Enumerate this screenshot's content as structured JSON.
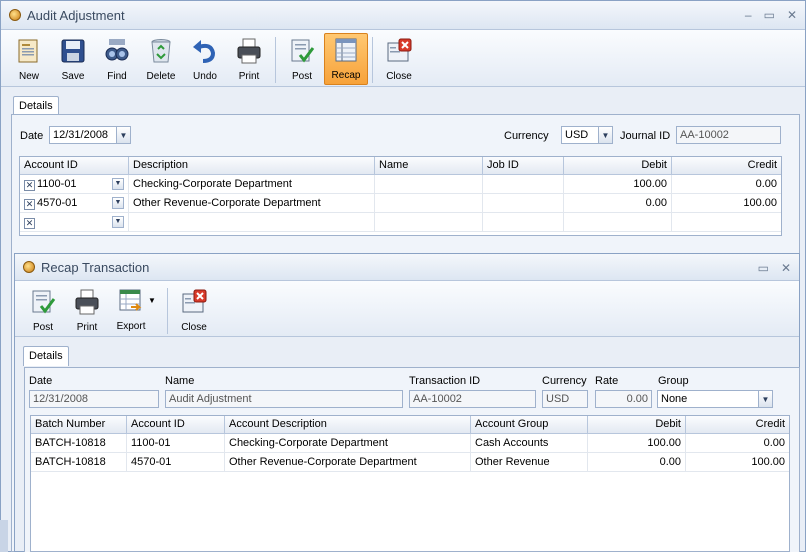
{
  "main_window": {
    "title": "Audit Adjustment",
    "toolbar": [
      {
        "label": "New",
        "icon": "new-icon"
      },
      {
        "label": "Save",
        "icon": "save-icon"
      },
      {
        "label": "Find",
        "icon": "find-icon"
      },
      {
        "label": "Delete",
        "icon": "delete-icon"
      },
      {
        "label": "Undo",
        "icon": "undo-icon"
      },
      {
        "label": "Print",
        "icon": "print-icon"
      },
      {
        "label": "Post",
        "icon": "post-icon"
      },
      {
        "label": "Recap",
        "icon": "recap-icon",
        "active": true
      },
      {
        "label": "Close",
        "icon": "close-icon"
      }
    ],
    "tab": "Details",
    "date_label": "Date",
    "date_value": "12/31/2008",
    "currency_label": "Currency",
    "currency_value": "USD",
    "journal_label": "Journal ID",
    "journal_value": "AA-10002",
    "grid": {
      "columns": [
        "Account ID",
        "Description",
        "Name",
        "Job ID",
        "Debit",
        "Credit"
      ],
      "rows": [
        {
          "account": "1100-01",
          "description": "Checking-Corporate Department",
          "name": "",
          "job": "",
          "debit": "100.00",
          "credit": "0.00"
        },
        {
          "account": "4570-01",
          "description": "Other Revenue-Corporate Department",
          "name": "",
          "job": "",
          "debit": "0.00",
          "credit": "100.00"
        },
        {
          "account": "",
          "description": "",
          "name": "",
          "job": "",
          "debit": "",
          "credit": ""
        }
      ]
    }
  },
  "recap_window": {
    "title": "Recap Transaction",
    "toolbar": [
      {
        "label": "Post",
        "icon": "post-icon"
      },
      {
        "label": "Print",
        "icon": "print-icon"
      },
      {
        "label": "Export",
        "icon": "export-icon"
      },
      {
        "label": "Close",
        "icon": "close-icon"
      }
    ],
    "tab": "Details",
    "fields": {
      "date_label": "Date",
      "date_value": "12/31/2008",
      "name_label": "Name",
      "name_value": "Audit Adjustment",
      "txn_label": "Transaction ID",
      "txn_value": "AA-10002",
      "currency_label": "Currency",
      "currency_value": "USD",
      "rate_label": "Rate",
      "rate_value": "0.00",
      "group_label": "Group",
      "group_value": "None"
    },
    "grid": {
      "columns": [
        "Batch Number",
        "Account ID",
        "Account Description",
        "Account Group",
        "Debit",
        "Credit"
      ],
      "rows": [
        {
          "batch": "BATCH-10818",
          "account": "1100-01",
          "description": "Checking-Corporate Department",
          "group": "Cash Accounts",
          "debit": "100.00",
          "credit": "0.00"
        },
        {
          "batch": "BATCH-10818",
          "account": "4570-01",
          "description": "Other Revenue-Corporate Department",
          "group": "Other Revenue",
          "debit": "0.00",
          "credit": "100.00"
        }
      ]
    }
  }
}
